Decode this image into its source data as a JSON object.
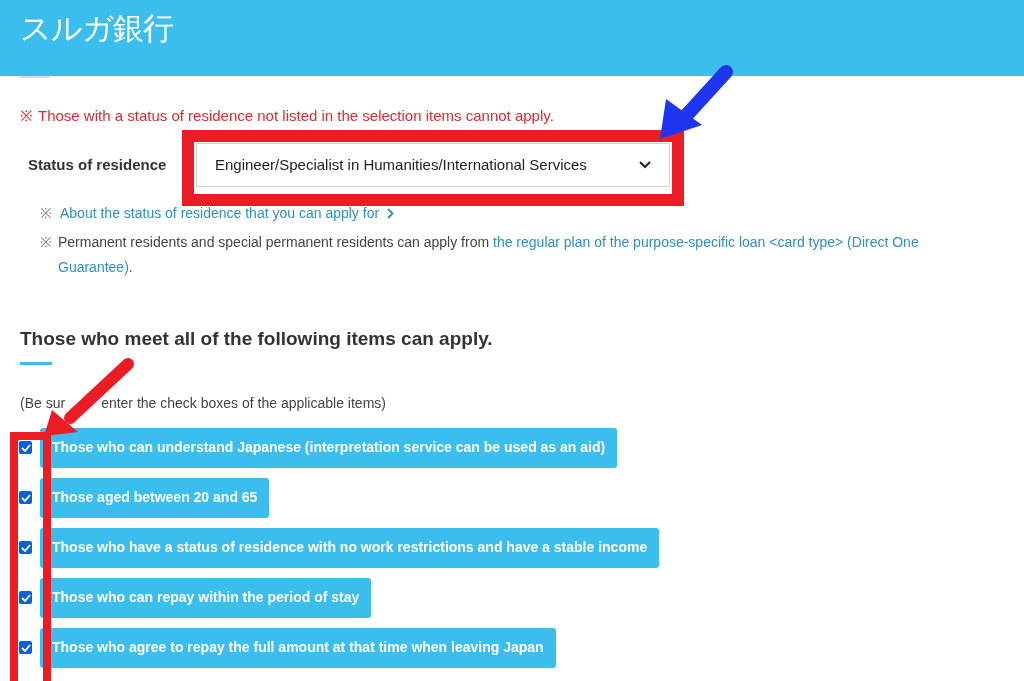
{
  "header": {
    "title": "スルガ銀行"
  },
  "warning": {
    "mark": "※",
    "text": "Those with a status of residence not listed in the selection items cannot apply."
  },
  "residence": {
    "label": "Status of residence",
    "value": "Engineer/Specialist in Humanities/International Services"
  },
  "about_note": {
    "mark": "※",
    "link": "About the status of residence that you can apply for"
  },
  "permanent_note": {
    "mark": "※",
    "text": "Permanent residents and special permanent residents can apply from ",
    "link_line1": "the regular plan of the purpose-specific loan <card type> (Direct One",
    "link_line2": "Guarantee)",
    "end": "."
  },
  "section": {
    "heading": "Those who meet all of the following items can apply.",
    "note_start": "(Be sur",
    "note_end": "enter the check boxes of the applicable items)"
  },
  "items": [
    {
      "label": "Those who can understand Japanese (interpretation service can be used as an aid)",
      "checked": true
    },
    {
      "label": "Those aged between 20 and 65",
      "checked": true
    },
    {
      "label": "Those who have a status of residence with no work restrictions and have a stable income",
      "checked": true
    },
    {
      "label": "Those who can repay within the period of stay",
      "checked": true
    },
    {
      "label": "Those who agree to repay the full amount at that time when leaving Japan",
      "checked": true
    }
  ]
}
